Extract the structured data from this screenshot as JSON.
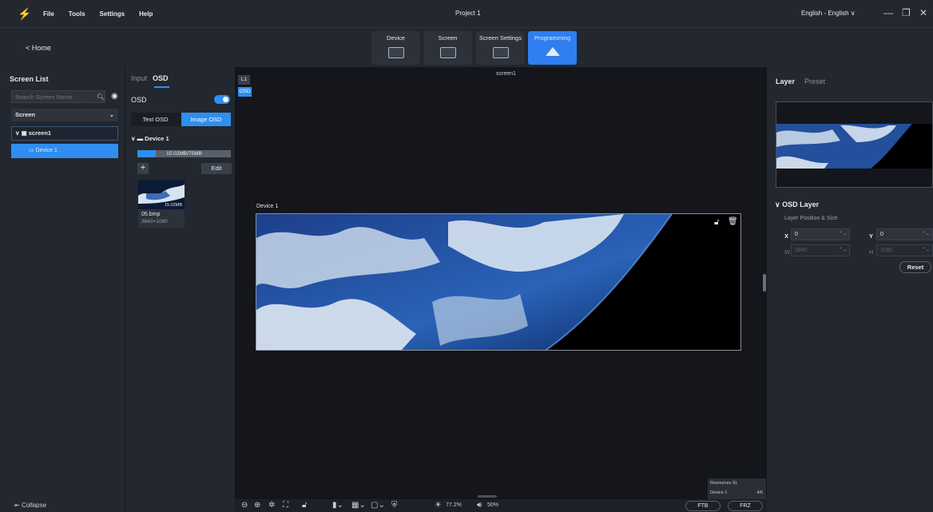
{
  "menubar": {
    "menus": [
      "File",
      "Tools",
      "Settings",
      "Help"
    ],
    "project_title": "Project 1",
    "language": "English - English ∨"
  },
  "toolbar": {
    "home": "< Home",
    "tabs": [
      {
        "label": "Device"
      },
      {
        "label": "Screen"
      },
      {
        "label": "Screen Settings"
      },
      {
        "label": "Programming"
      }
    ],
    "active_tab": "Programming",
    "accent": "#2f8ef0"
  },
  "screen_list": {
    "title": "Screen List",
    "search_placeholder": "Search Screen Name",
    "filter": "Screen",
    "screen_item": "screen1",
    "device_item": "Device 1",
    "collapse": "Collapse"
  },
  "osd_panel": {
    "tab_input": "Input",
    "tab_osd": "OSD",
    "osd_label": "OSD",
    "osd_enabled": true,
    "segment_text": "Text OSD",
    "segment_image": "Image OSD",
    "device_header": "Device 1",
    "storage_text": "15.02MB/75MB",
    "storage_fraction": 0.2,
    "edit": "Edit",
    "add": "+",
    "media": {
      "size": "15.02MB",
      "name": "05.bmp",
      "resolution": "3840×1080"
    }
  },
  "canvas": {
    "layer_tag": "L1",
    "osd_tag": "OSD",
    "screen_name": "screen1",
    "device_name": "Device 1",
    "frame_osd_label": "OSD",
    "resources_title": "Resources SL",
    "resources_device": "Device 1",
    "resources_count": "4/6"
  },
  "bottombar": {
    "zoom": "77.2%",
    "volume": "50%",
    "ftb": "FTB",
    "frz": "FRZ"
  },
  "right_panel": {
    "tab_layer": "Layer",
    "tab_preset": "Preset",
    "section": "OSD Layer",
    "position_label": "Layer Position & Size",
    "x_label": "X",
    "x_value": "0",
    "y_label": "Y",
    "y_value": "0",
    "w_label": "W",
    "w_value": "3840",
    "h_label": "H",
    "h_value": "1080",
    "reset": "Reset"
  }
}
